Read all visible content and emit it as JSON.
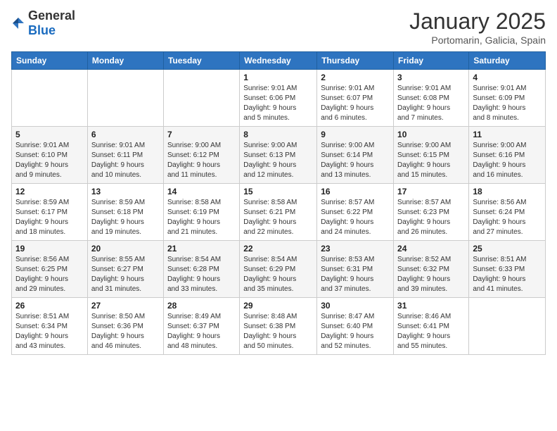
{
  "logo": {
    "general": "General",
    "blue": "Blue"
  },
  "title": "January 2025",
  "location": "Portomarin, Galicia, Spain",
  "weekdays": [
    "Sunday",
    "Monday",
    "Tuesday",
    "Wednesday",
    "Thursday",
    "Friday",
    "Saturday"
  ],
  "weeks": [
    [
      {
        "day": "",
        "info": ""
      },
      {
        "day": "",
        "info": ""
      },
      {
        "day": "",
        "info": ""
      },
      {
        "day": "1",
        "info": "Sunrise: 9:01 AM\nSunset: 6:06 PM\nDaylight: 9 hours\nand 5 minutes."
      },
      {
        "day": "2",
        "info": "Sunrise: 9:01 AM\nSunset: 6:07 PM\nDaylight: 9 hours\nand 6 minutes."
      },
      {
        "day": "3",
        "info": "Sunrise: 9:01 AM\nSunset: 6:08 PM\nDaylight: 9 hours\nand 7 minutes."
      },
      {
        "day": "4",
        "info": "Sunrise: 9:01 AM\nSunset: 6:09 PM\nDaylight: 9 hours\nand 8 minutes."
      }
    ],
    [
      {
        "day": "5",
        "info": "Sunrise: 9:01 AM\nSunset: 6:10 PM\nDaylight: 9 hours\nand 9 minutes."
      },
      {
        "day": "6",
        "info": "Sunrise: 9:01 AM\nSunset: 6:11 PM\nDaylight: 9 hours\nand 10 minutes."
      },
      {
        "day": "7",
        "info": "Sunrise: 9:00 AM\nSunset: 6:12 PM\nDaylight: 9 hours\nand 11 minutes."
      },
      {
        "day": "8",
        "info": "Sunrise: 9:00 AM\nSunset: 6:13 PM\nDaylight: 9 hours\nand 12 minutes."
      },
      {
        "day": "9",
        "info": "Sunrise: 9:00 AM\nSunset: 6:14 PM\nDaylight: 9 hours\nand 13 minutes."
      },
      {
        "day": "10",
        "info": "Sunrise: 9:00 AM\nSunset: 6:15 PM\nDaylight: 9 hours\nand 15 minutes."
      },
      {
        "day": "11",
        "info": "Sunrise: 9:00 AM\nSunset: 6:16 PM\nDaylight: 9 hours\nand 16 minutes."
      }
    ],
    [
      {
        "day": "12",
        "info": "Sunrise: 8:59 AM\nSunset: 6:17 PM\nDaylight: 9 hours\nand 18 minutes."
      },
      {
        "day": "13",
        "info": "Sunrise: 8:59 AM\nSunset: 6:18 PM\nDaylight: 9 hours\nand 19 minutes."
      },
      {
        "day": "14",
        "info": "Sunrise: 8:58 AM\nSunset: 6:19 PM\nDaylight: 9 hours\nand 21 minutes."
      },
      {
        "day": "15",
        "info": "Sunrise: 8:58 AM\nSunset: 6:21 PM\nDaylight: 9 hours\nand 22 minutes."
      },
      {
        "day": "16",
        "info": "Sunrise: 8:57 AM\nSunset: 6:22 PM\nDaylight: 9 hours\nand 24 minutes."
      },
      {
        "day": "17",
        "info": "Sunrise: 8:57 AM\nSunset: 6:23 PM\nDaylight: 9 hours\nand 26 minutes."
      },
      {
        "day": "18",
        "info": "Sunrise: 8:56 AM\nSunset: 6:24 PM\nDaylight: 9 hours\nand 27 minutes."
      }
    ],
    [
      {
        "day": "19",
        "info": "Sunrise: 8:56 AM\nSunset: 6:25 PM\nDaylight: 9 hours\nand 29 minutes."
      },
      {
        "day": "20",
        "info": "Sunrise: 8:55 AM\nSunset: 6:27 PM\nDaylight: 9 hours\nand 31 minutes."
      },
      {
        "day": "21",
        "info": "Sunrise: 8:54 AM\nSunset: 6:28 PM\nDaylight: 9 hours\nand 33 minutes."
      },
      {
        "day": "22",
        "info": "Sunrise: 8:54 AM\nSunset: 6:29 PM\nDaylight: 9 hours\nand 35 minutes."
      },
      {
        "day": "23",
        "info": "Sunrise: 8:53 AM\nSunset: 6:31 PM\nDaylight: 9 hours\nand 37 minutes."
      },
      {
        "day": "24",
        "info": "Sunrise: 8:52 AM\nSunset: 6:32 PM\nDaylight: 9 hours\nand 39 minutes."
      },
      {
        "day": "25",
        "info": "Sunrise: 8:51 AM\nSunset: 6:33 PM\nDaylight: 9 hours\nand 41 minutes."
      }
    ],
    [
      {
        "day": "26",
        "info": "Sunrise: 8:51 AM\nSunset: 6:34 PM\nDaylight: 9 hours\nand 43 minutes."
      },
      {
        "day": "27",
        "info": "Sunrise: 8:50 AM\nSunset: 6:36 PM\nDaylight: 9 hours\nand 46 minutes."
      },
      {
        "day": "28",
        "info": "Sunrise: 8:49 AM\nSunset: 6:37 PM\nDaylight: 9 hours\nand 48 minutes."
      },
      {
        "day": "29",
        "info": "Sunrise: 8:48 AM\nSunset: 6:38 PM\nDaylight: 9 hours\nand 50 minutes."
      },
      {
        "day": "30",
        "info": "Sunrise: 8:47 AM\nSunset: 6:40 PM\nDaylight: 9 hours\nand 52 minutes."
      },
      {
        "day": "31",
        "info": "Sunrise: 8:46 AM\nSunset: 6:41 PM\nDaylight: 9 hours\nand 55 minutes."
      },
      {
        "day": "",
        "info": ""
      }
    ]
  ]
}
